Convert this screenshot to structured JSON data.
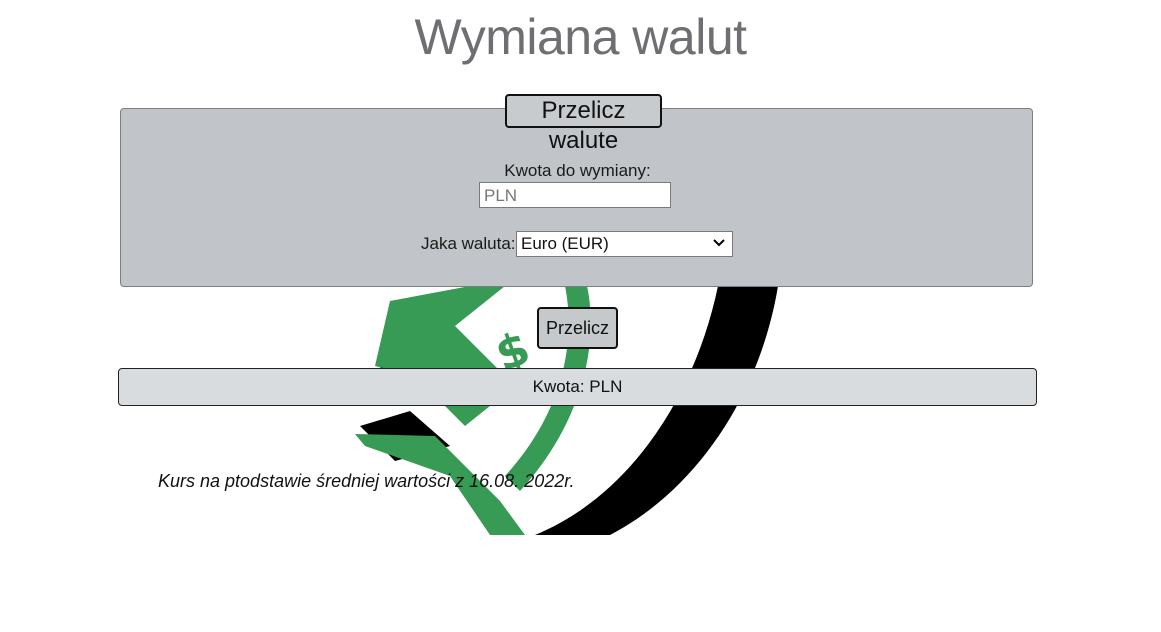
{
  "header": {
    "title": "Wymiana walut"
  },
  "form": {
    "legend": "Przelicz walute",
    "amount_label": "Kwota do wymiany:",
    "amount_placeholder": "PLN",
    "currency_label": "Jaka waluta:",
    "currency_selected": "Euro (EUR)",
    "calc_button": "Przelicz"
  },
  "result": {
    "text": "Kwota: PLN"
  },
  "footer": {
    "note": "Kurs na ptodstawie średniej wartości z 16.08. 2022r."
  },
  "colors": {
    "panel": "#c1c5c9",
    "result": "#d9dcdf",
    "title": "#6f6f73",
    "logo_green": "#379a55",
    "logo_black": "#000000"
  },
  "icons": {
    "select_arrow": "chevron-down-icon",
    "logo": "currency-exchange-logo"
  }
}
